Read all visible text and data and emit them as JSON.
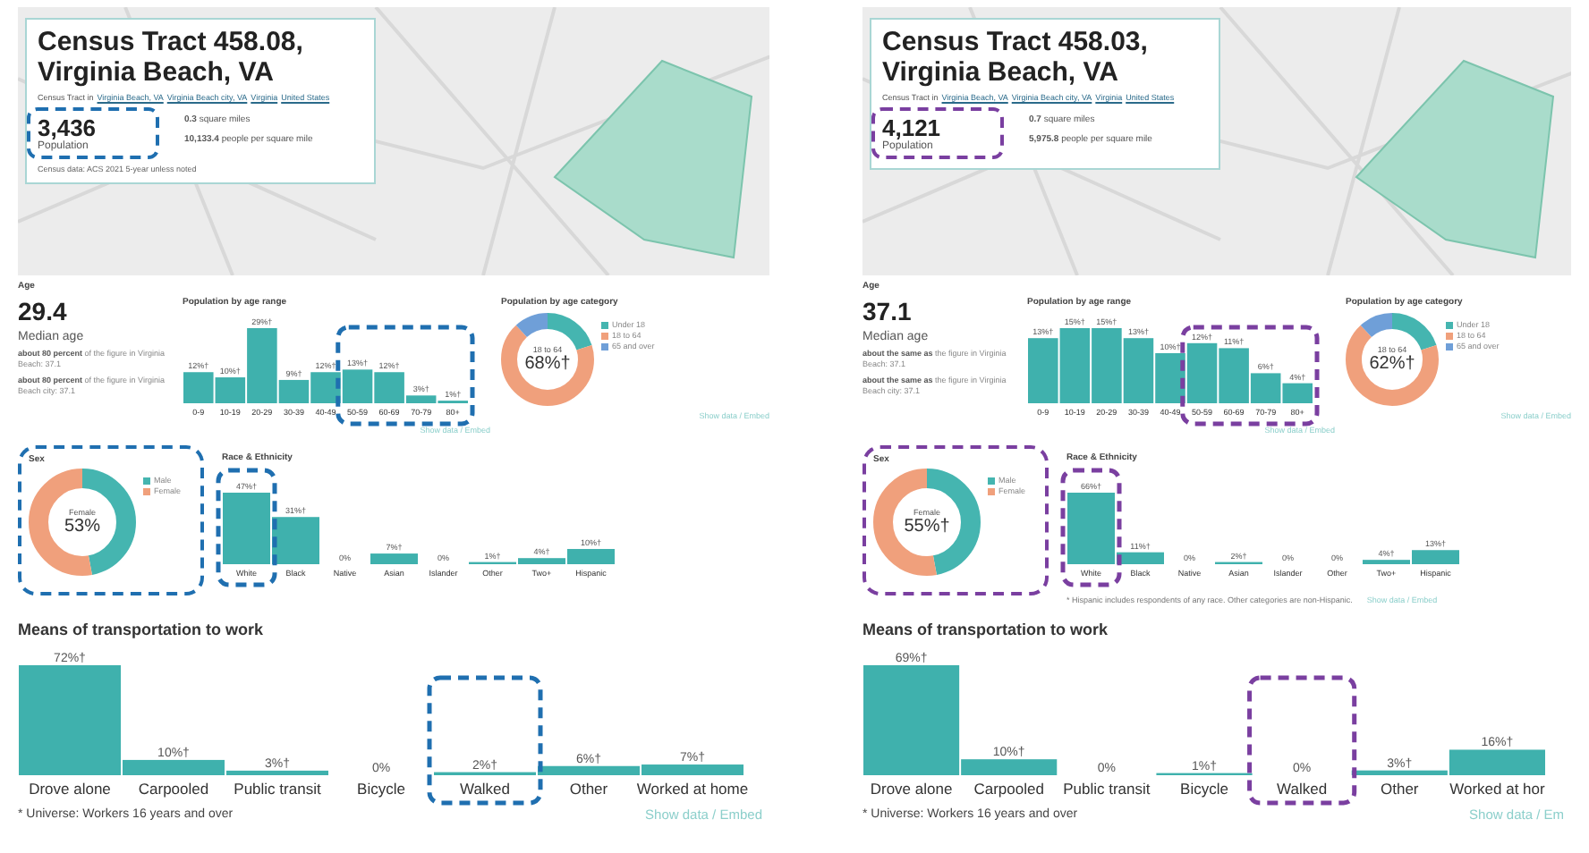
{
  "panels": [
    {
      "color": "#1f6fb0",
      "title": "Census Tract 458.08, Virginia Beach, VA",
      "breadcrumb": {
        "prefix": "Census Tract in",
        "links": [
          "Virginia Beach, VA",
          "Virginia Beach city, VA",
          "Virginia",
          "United States"
        ]
      },
      "population": {
        "value": "3,436",
        "label": "Population",
        "highlighted": true
      },
      "area": {
        "value": "0.3",
        "unit": "square miles"
      },
      "density": {
        "value": "10,133.4",
        "unit": "people per square mile"
      },
      "source_note": "Census data: ACS 2021 5-year unless noted",
      "age": {
        "heading": "Age",
        "median": "29.4",
        "median_label": "Median age",
        "comparisons": [
          "**about 80 percent** of the figure in Virginia Beach: 37.1",
          "**about 80 percent** of the figure in Virginia Beach city: 37.1"
        ],
        "range_chart": {
          "title": "Population by age range",
          "chart_data": {
            "type": "bar",
            "categories": [
              "0-9",
              "10-19",
              "20-29",
              "30-39",
              "40-49",
              "50-59",
              "60-69",
              "70-79",
              "80+"
            ],
            "values": [
              12,
              10,
              29,
              9,
              12,
              13,
              12,
              3,
              1
            ],
            "value_labels": [
              "12%†",
              "10%†",
              "29%†",
              "9%†",
              "12%†",
              "13%†",
              "12%†",
              "3%†",
              "1%†"
            ]
          },
          "highlighted": [
            false,
            false,
            false,
            false,
            false,
            true,
            true,
            true,
            true
          ],
          "footer": "Show data / Embed"
        },
        "category_chart": {
          "title": "Population by age category",
          "center_label": "18 to 64",
          "center_value": "68%†",
          "legend": [
            {
              "label": "Under 18",
              "color": "#45b5b0"
            },
            {
              "label": "18 to 64",
              "color": "#f0a07c"
            },
            {
              "label": "65 and over",
              "color": "#6f9fd8"
            }
          ],
          "footer": "Show data / Embed"
        }
      },
      "sex": {
        "heading": "Sex",
        "center_label": "Female",
        "center_value": "53%",
        "legend": [
          {
            "label": "Male",
            "color": "#45b5b0"
          },
          {
            "label": "Female",
            "color": "#f0a07c"
          }
        ],
        "highlighted": true
      },
      "race": {
        "heading": "Race & Ethnicity",
        "chart_data": {
          "type": "bar",
          "categories": [
            "White",
            "Black",
            "Native",
            "Asian",
            "Islander",
            "Other",
            "Two+",
            "Hispanic"
          ],
          "values": [
            47,
            31,
            0,
            7,
            0,
            1,
            4,
            10
          ],
          "value_labels": [
            "47%†",
            "31%†",
            "0%",
            "7%†",
            "0%",
            "1%†",
            "4%†",
            "10%†"
          ]
        },
        "highlighted": [
          true,
          false,
          false,
          false,
          false,
          false,
          false,
          false
        ]
      },
      "transport": {
        "heading": "Means of transportation to work",
        "chart_data": {
          "type": "bar",
          "categories": [
            "Drove alone",
            "Carpooled",
            "Public transit",
            "Bicycle",
            "Walked",
            "Other",
            "Worked at home"
          ],
          "values": [
            72,
            10,
            3,
            0,
            2,
            6,
            7
          ],
          "value_labels": [
            "72%†",
            "10%†",
            "3%†",
            "0%",
            "2%†",
            "6%†",
            "7%†"
          ]
        },
        "highlighted": [
          false,
          false,
          false,
          false,
          true,
          false,
          false
        ],
        "universe_note": "* Universe: Workers 16 years and over",
        "footer": "Show data / Embed"
      }
    },
    {
      "color": "#7a3fa0",
      "title": "Census Tract 458.03, Virginia Beach, VA",
      "breadcrumb": {
        "prefix": "Census Tract in",
        "links": [
          "Virginia Beach, VA",
          "Virginia Beach city, VA",
          "Virginia",
          "United States"
        ]
      },
      "population": {
        "value": "4,121",
        "label": "Population",
        "highlighted": true
      },
      "area": {
        "value": "0.7",
        "unit": "square miles"
      },
      "density": {
        "value": "5,975.8",
        "unit": "people per square mile"
      },
      "age": {
        "heading": "Age",
        "median": "37.1",
        "median_label": "Median age",
        "comparisons": [
          "**about the same as** the figure in Virginia Beach: 37.1",
          "**about the same as** the figure in Virginia Beach city: 37.1"
        ],
        "range_chart": {
          "title": "Population by age range",
          "chart_data": {
            "type": "bar",
            "categories": [
              "0-9",
              "10-19",
              "20-29",
              "30-39",
              "40-49",
              "50-59",
              "60-69",
              "70-79",
              "80+"
            ],
            "values": [
              13,
              15,
              15,
              13,
              10,
              12,
              11,
              6,
              4
            ],
            "value_labels": [
              "13%†",
              "15%†",
              "15%†",
              "13%†",
              "10%†",
              "12%†",
              "11%†",
              "6%†",
              "4%†"
            ]
          },
          "highlighted": [
            false,
            false,
            false,
            false,
            false,
            true,
            true,
            true,
            true
          ],
          "footer": "Show data / Embed"
        },
        "category_chart": {
          "title": "Population by age category",
          "center_label": "18 to 64",
          "center_value": "62%†",
          "legend": [
            {
              "label": "Under 18",
              "color": "#45b5b0"
            },
            {
              "label": "18 to 64",
              "color": "#f0a07c"
            },
            {
              "label": "65 and over",
              "color": "#6f9fd8"
            }
          ],
          "footer": "Show data / Embed"
        }
      },
      "sex": {
        "heading": "Sex",
        "center_label": "Female",
        "center_value": "55%†",
        "legend": [
          {
            "label": "Male",
            "color": "#45b5b0"
          },
          {
            "label": "Female",
            "color": "#f0a07c"
          }
        ],
        "highlighted": true
      },
      "race": {
        "heading": "Race & Ethnicity",
        "chart_data": {
          "type": "bar",
          "categories": [
            "White",
            "Black",
            "Native",
            "Asian",
            "Islander",
            "Other",
            "Two+",
            "Hispanic"
          ],
          "values": [
            66,
            11,
            0,
            2,
            0,
            0,
            4,
            13
          ],
          "value_labels": [
            "66%†",
            "11%†",
            "0%",
            "2%†",
            "0%",
            "0%",
            "4%†",
            "13%†"
          ]
        },
        "highlighted": [
          true,
          false,
          false,
          false,
          false,
          false,
          false,
          false
        ],
        "note": "* Hispanic includes respondents of any race. Other categories are non-Hispanic.",
        "footer": "Show data / Embed"
      },
      "transport": {
        "heading": "Means of transportation to work",
        "chart_data": {
          "type": "bar",
          "categories": [
            "Drove alone",
            "Carpooled",
            "Public transit",
            "Bicycle",
            "Walked",
            "Other",
            "Worked at hor"
          ],
          "values": [
            69,
            10,
            0,
            1,
            0,
            3,
            16
          ],
          "value_labels": [
            "69%†",
            "10%†",
            "0%",
            "1%†",
            "0%",
            "3%†",
            "16%†"
          ]
        },
        "highlighted": [
          false,
          false,
          false,
          false,
          true,
          false,
          false
        ],
        "universe_note": "* Universe: Workers 16 years and over",
        "footer": "Show data / Em"
      }
    }
  ]
}
